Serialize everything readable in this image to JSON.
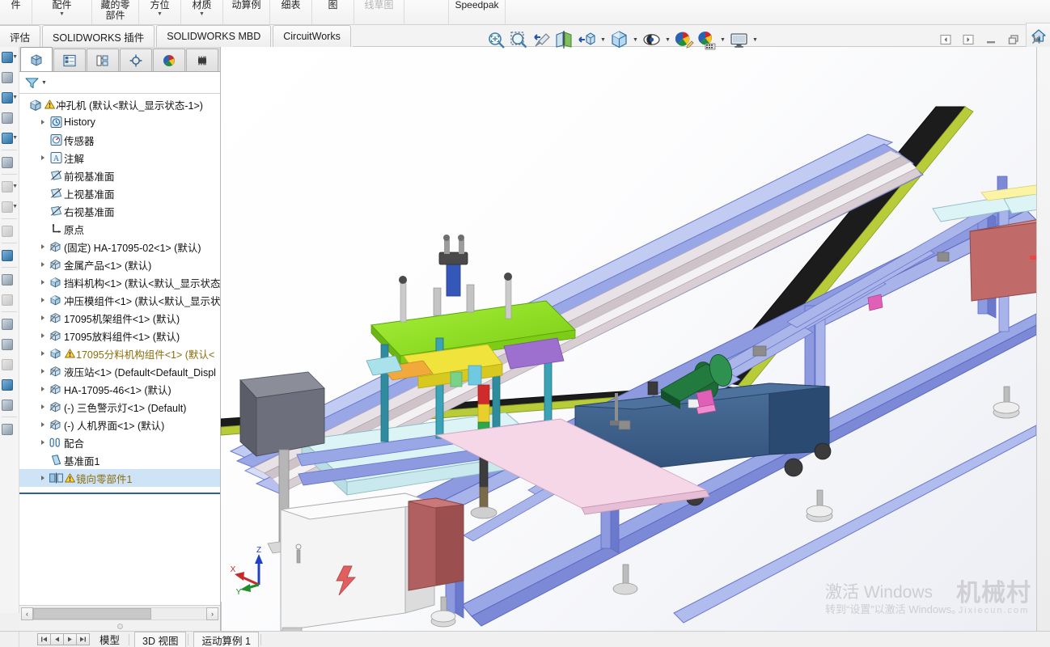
{
  "app": {
    "title": "SOLIDWORKS",
    "accent": "#2b5fa8",
    "warning_color": "#8a6d0b",
    "selection_color": "#cfe3f7"
  },
  "ribbon": {
    "buttons": [
      {
        "label": "件",
        "caret": false,
        "dim": false
      },
      {
        "label": "配件",
        "caret": true,
        "dim": false
      },
      {
        "label": "藏的零\n部件",
        "caret": false,
        "dim": false
      },
      {
        "label": "方位",
        "caret": true,
        "dim": false
      },
      {
        "label": "材质",
        "caret": true,
        "dim": false
      },
      {
        "label": "动算例",
        "caret": false,
        "dim": false
      },
      {
        "label": "细表",
        "caret": false,
        "dim": false
      },
      {
        "label": "图",
        "caret": false,
        "dim": false
      },
      {
        "label": "线草图",
        "caret": false,
        "dim": true
      },
      {
        "label": "",
        "caret": false,
        "dim": false
      },
      {
        "label": "Speedpak",
        "caret": false,
        "dim": false
      }
    ]
  },
  "tabbar": {
    "tabs": [
      {
        "label": "评估",
        "clipped": true
      },
      {
        "label": "SOLIDWORKS 插件",
        "clipped": false
      },
      {
        "label": "SOLIDWORKS MBD",
        "clipped": false
      },
      {
        "label": "CircuitWorks",
        "clipped": false
      }
    ]
  },
  "view_toolbar": {
    "items": [
      {
        "name": "zoom-to-fit-icon",
        "caret": false
      },
      {
        "name": "zoom-to-area-icon",
        "caret": false
      },
      {
        "name": "previous-view-icon",
        "caret": false
      },
      {
        "name": "section-view-icon",
        "caret": false
      },
      {
        "name": "view-orientation-icon",
        "caret": false
      },
      {
        "name": "display-style-icon",
        "caret": true
      },
      {
        "name": "hide-show-items-icon",
        "caret": true
      },
      {
        "name": "edit-appearance-icon",
        "caret": false
      },
      {
        "name": "apply-scene-icon",
        "caret": true
      },
      {
        "name": "view-settings-icon",
        "caret": true
      }
    ]
  },
  "window_controls": [
    {
      "name": "collapse-left-panel-button"
    },
    {
      "name": "collapse-right-panel-button"
    },
    {
      "name": "minimize-button"
    },
    {
      "name": "restore-button"
    },
    {
      "name": "close-button"
    }
  ],
  "feature_manager": {
    "tabs": [
      {
        "name": "feature-manager-tab",
        "active": true
      },
      {
        "name": "property-manager-tab",
        "active": false
      },
      {
        "name": "configuration-manager-tab",
        "active": false
      },
      {
        "name": "dimxpert-manager-tab",
        "active": false
      },
      {
        "name": "display-manager-tab",
        "active": false
      },
      {
        "name": "addins-manager-tab",
        "active": false
      }
    ],
    "filter": {
      "name": "filter-icon",
      "placeholder": ""
    },
    "tree": [
      {
        "label": "冲孔机  (默认<默认_显示状态-1>)",
        "icon": "assembly-icon",
        "indent": 0,
        "expand": false,
        "warn": true,
        "selected": false
      },
      {
        "label": "History",
        "icon": "history-icon",
        "indent": 1,
        "expand": true,
        "warn": false,
        "selected": false
      },
      {
        "label": "传感器",
        "icon": "sensors-icon",
        "indent": 1,
        "expand": false,
        "warn": false,
        "selected": false
      },
      {
        "label": "注解",
        "icon": "annotations-icon",
        "indent": 1,
        "expand": true,
        "warn": false,
        "selected": false
      },
      {
        "label": "前视基准面",
        "icon": "plane-icon",
        "indent": 1,
        "expand": false,
        "warn": false,
        "selected": false
      },
      {
        "label": "上视基准面",
        "icon": "plane-icon",
        "indent": 1,
        "expand": false,
        "warn": false,
        "selected": false
      },
      {
        "label": "右视基准面",
        "icon": "plane-icon",
        "indent": 1,
        "expand": false,
        "warn": false,
        "selected": false
      },
      {
        "label": "原点",
        "icon": "origin-icon",
        "indent": 1,
        "expand": false,
        "warn": false,
        "selected": false
      },
      {
        "label": "(固定) HA-17095-02<1>  (默认)",
        "icon": "part-icon",
        "indent": 1,
        "expand": true,
        "warn": false,
        "selected": false
      },
      {
        "label": "金属产品<1>  (默认)",
        "icon": "part-icon",
        "indent": 1,
        "expand": true,
        "warn": false,
        "selected": false
      },
      {
        "label": "挡料机构<1>  (默认<默认_显示状态-",
        "icon": "subassembly-icon",
        "indent": 1,
        "expand": true,
        "warn": false,
        "selected": false
      },
      {
        "label": "冲压模组件<1>  (默认<默认_显示状态",
        "icon": "subassembly-icon",
        "indent": 1,
        "expand": true,
        "warn": false,
        "selected": false
      },
      {
        "label": "17095机架组件<1>  (默认)",
        "icon": "part-icon",
        "indent": 1,
        "expand": true,
        "warn": false,
        "selected": false
      },
      {
        "label": "17095放料组件<1>  (默认)",
        "icon": "part-icon",
        "indent": 1,
        "expand": true,
        "warn": false,
        "selected": false
      },
      {
        "label": "17095分料机构组件<1>  (默认<",
        "icon": "subassembly-icon",
        "indent": 1,
        "expand": true,
        "warn": true,
        "selected": false
      },
      {
        "label": "液压站<1>  (Default<Default_Displ",
        "icon": "part-icon",
        "indent": 1,
        "expand": true,
        "warn": false,
        "selected": false
      },
      {
        "label": "HA-17095-46<1>  (默认)",
        "icon": "part-icon",
        "indent": 1,
        "expand": true,
        "warn": false,
        "selected": false
      },
      {
        "label": "(-) 三色警示灯<1>  (Default)",
        "icon": "part-icon",
        "indent": 1,
        "expand": true,
        "warn": false,
        "selected": false
      },
      {
        "label": "(-) 人机界面<1>  (默认)",
        "icon": "part-icon",
        "indent": 1,
        "expand": true,
        "warn": false,
        "selected": false
      },
      {
        "label": "配合",
        "icon": "mates-icon",
        "indent": 1,
        "expand": true,
        "warn": false,
        "selected": false
      },
      {
        "label": "基准面1",
        "icon": "plane-feature-icon",
        "indent": 1,
        "expand": false,
        "warn": false,
        "selected": false
      },
      {
        "label": "镜向零部件1",
        "icon": "mirror-components-icon",
        "indent": 1,
        "expand": true,
        "warn": true,
        "selected": true
      }
    ],
    "scrollbar": {
      "left_arrow": "‹",
      "right_arrow": "›"
    }
  },
  "task_pane": {
    "items": [
      {
        "name": "solidworks-resources-icon"
      },
      {
        "name": "design-library-icon"
      },
      {
        "name": "file-explorer-icon"
      },
      {
        "name": "view-palette-icon"
      },
      {
        "name": "appearances-scenes-decals-icon"
      },
      {
        "name": "custom-properties-icon"
      },
      {
        "name": "solidworks-forum-icon"
      }
    ]
  },
  "bottom_bar": {
    "nav_buttons": [
      "⏮",
      "◀",
      "▶",
      "⏭"
    ],
    "tabs": [
      {
        "label": "模型",
        "boxed": false
      },
      {
        "label": "3D 视图",
        "boxed": true
      },
      {
        "label": "运动算例 1",
        "boxed": true
      }
    ]
  },
  "viewport": {
    "triad": {
      "x_label": "X",
      "y_label": "Y",
      "z_label": "Z",
      "x_color": "#c42b2b",
      "y_color": "#1f8f2a",
      "z_color": "#2040c8"
    },
    "watermark_windows": {
      "line1": "激活 Windows",
      "line2": "转到“设置”以激活 Windows。"
    },
    "watermark_site": {
      "name": "机械村",
      "domain": "Jixiecun.com"
    },
    "model": {
      "name": "冲孔机",
      "description": "自动冲孔机装配体等轴测视图",
      "colors": {
        "frame_blue": "#8d9ae0",
        "frame_blue_dark": "#6b79cc",
        "frame_blue_light": "#b0bbee",
        "press_plate_green": "#8fe020",
        "press_plate_green_dark": "#6cb516",
        "bin_red": "#c06a6a",
        "bin_red_dark": "#a04f4f",
        "tank_blue": "#3e6390",
        "tank_blue_dark": "#2f4c70",
        "motor_green": "#1d6b36",
        "motor_green_dark": "#14512a",
        "sheet_pink": "#f6d7e8",
        "sheet_cyan": "#ddf4f7",
        "cabinet_white": "#f2f2f2",
        "cabinet_gray": "#d9d9d9",
        "hmi_gray": "#575a66",
        "rail_black": "#1a1a1a",
        "rail_olive": "#b8cc3a",
        "post_teal": "#2f8c9e",
        "yellow_part": "#f0e43c"
      }
    }
  }
}
